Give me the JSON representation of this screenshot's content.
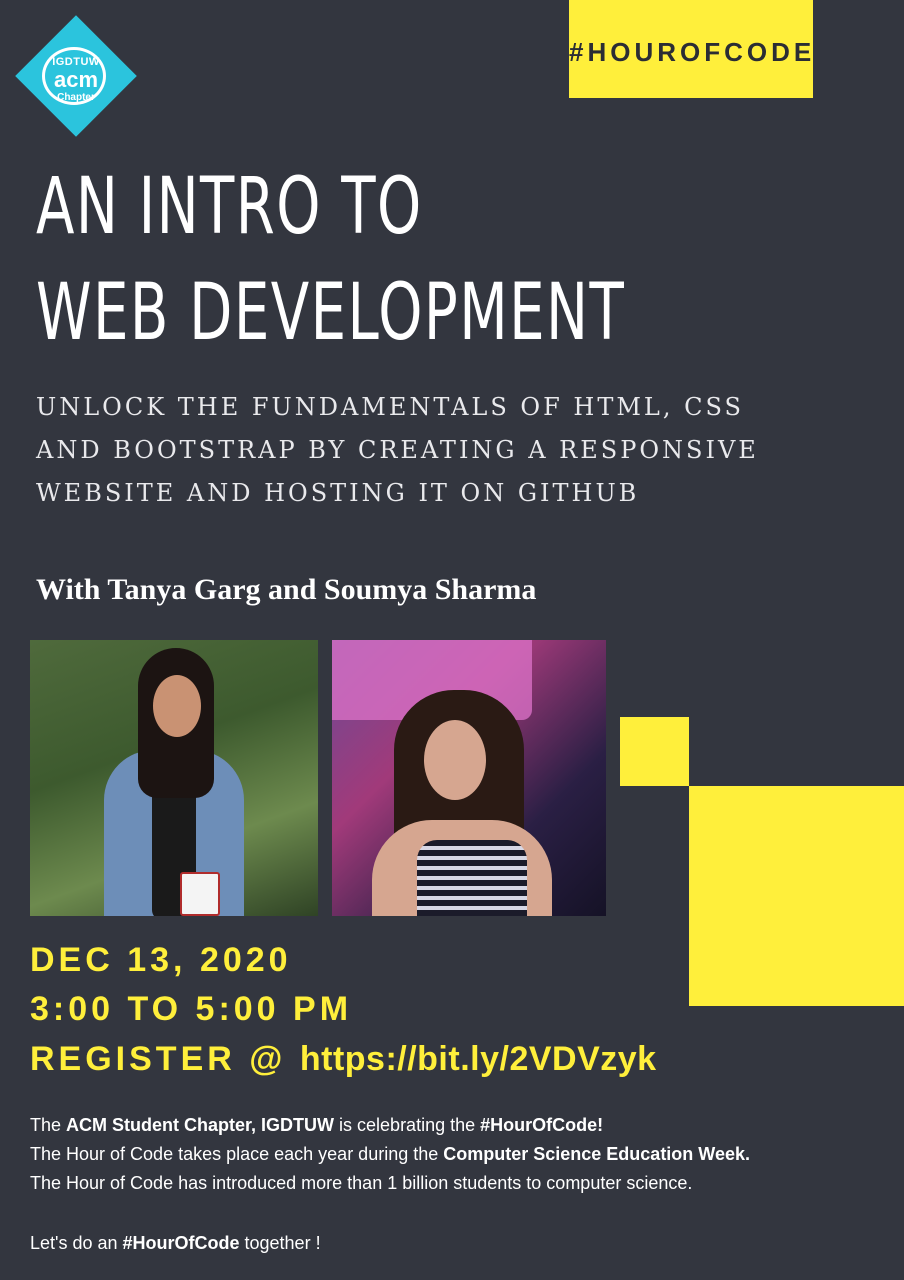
{
  "logo": {
    "line1": "IGDTUW",
    "line2": "acm",
    "line3": "Chapter"
  },
  "hashtag": "#HOUROFCODE",
  "title": {
    "line1": "AN INTRO TO",
    "line2": "WEB DEVELOPMENT"
  },
  "subtitle": {
    "line1": "UNLOCK THE FUNDAMENTALS OF HTML, CSS",
    "line2": "AND BOOTSTRAP BY CREATING A RESPONSIVE",
    "line3": "WEBSITE AND HOSTING IT ON GITHUB"
  },
  "presenters": "With Tanya Garg and Soumya Sharma",
  "event": {
    "date": "DEC 13, 2020",
    "time": "3:00 TO 5:00 PM",
    "register_label": "REGISTER @",
    "register_url": "https://bit.ly/2VDVzyk"
  },
  "description": {
    "p1_a": "The ",
    "p1_b": "ACM Student Chapter, IGDTUW",
    "p1_c": " is celebrating the ",
    "p1_d": "#HourOfCode!",
    "p2_a": "The Hour of Code takes place each year during the ",
    "p2_b": "Computer Science Education Week.",
    "p3": "The Hour of Code has introduced more than 1 billion students to computer science.",
    "p4_a": "Let's do an ",
    "p4_b": "#HourOfCode",
    "p4_c": " together !"
  },
  "colors": {
    "background": "#33363f",
    "accent_yellow": "#ffef3b",
    "logo_cyan": "#2bc4dd"
  }
}
